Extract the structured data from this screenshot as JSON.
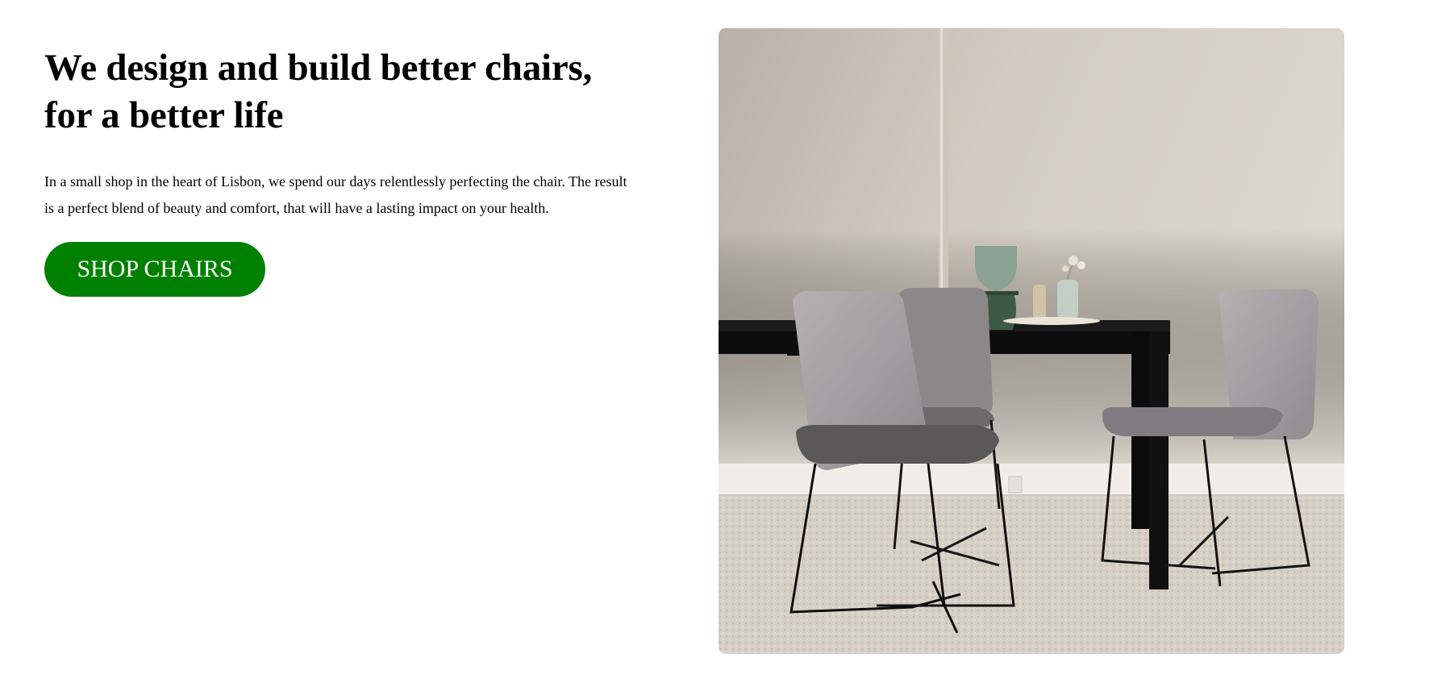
{
  "hero": {
    "headline_line1": "We design and build better chairs,",
    "headline_line2": "for a better life",
    "intro_line1": "In a small shop in the heart of Lisbon, we spend our days relentlessly perfecting the chair. The result",
    "intro_line2": "is a perfect blend of beauty and comfort, that will have a lasting impact on your health.",
    "cta_label": "SHOP CHAIRS"
  },
  "colors": {
    "cta_background": "#008000",
    "cta_text": "#ffffff"
  }
}
